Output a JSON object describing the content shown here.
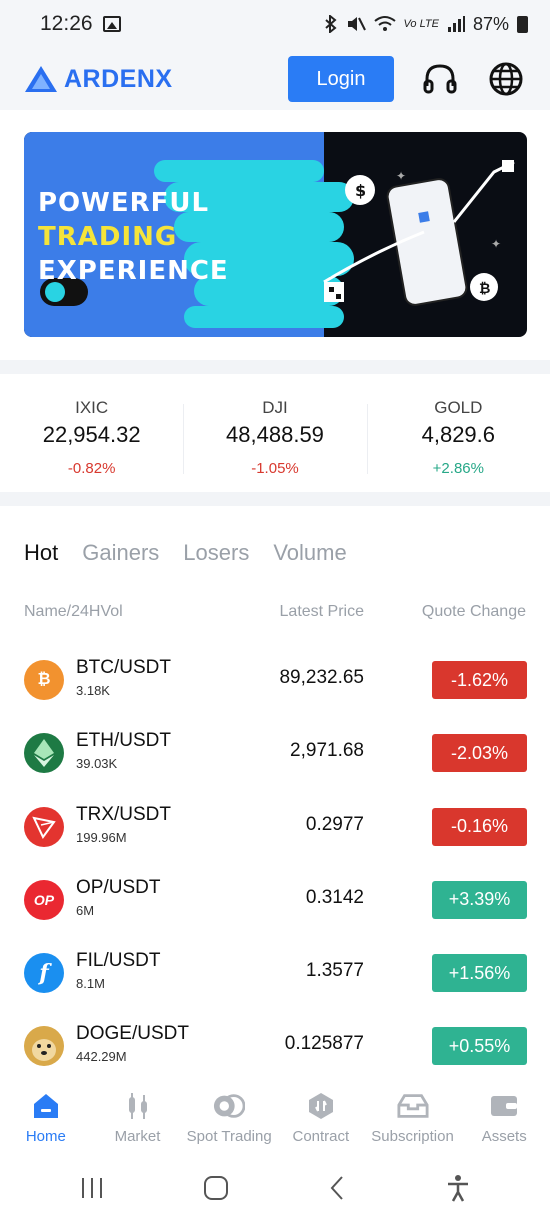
{
  "status_bar": {
    "time": "12:26",
    "battery": "87%",
    "network": "Vo LTE"
  },
  "header": {
    "logo_text": "ARDENX",
    "login_label": "Login",
    "support_icon": "headset-icon",
    "language_icon": "globe-icon"
  },
  "banner": {
    "line1": "POWERFUL",
    "line2": "TRADING",
    "line3": "EXPERIENCE"
  },
  "indices": [
    {
      "name": "IXIC",
      "value": "22,954.32",
      "change": "-0.82%",
      "trend": "down"
    },
    {
      "name": "DJI",
      "value": "48,488.59",
      "change": "-1.05%",
      "trend": "down"
    },
    {
      "name": "GOLD",
      "value": "4,829.6",
      "change": "+2.86%",
      "trend": "up"
    }
  ],
  "tabs": [
    "Hot",
    "Gainers",
    "Losers",
    "Volume"
  ],
  "active_tab": "Hot",
  "columns": {
    "name": "Name/24HVol",
    "price": "Latest Price",
    "change": "Quote Change"
  },
  "markets": [
    {
      "pair": "BTC/USDT",
      "volume": "3.18K",
      "price": "89,232.65",
      "change": "-1.62%",
      "trend": "down",
      "icon": "bitcoin-icon",
      "color": "#f2922f"
    },
    {
      "pair": "ETH/USDT",
      "volume": "39.03K",
      "price": "2,971.68",
      "change": "-2.03%",
      "trend": "down",
      "icon": "ethereum-icon",
      "color": "#1e7a44"
    },
    {
      "pair": "TRX/USDT",
      "volume": "199.96M",
      "price": "0.2977",
      "change": "-0.16%",
      "trend": "down",
      "icon": "tron-icon",
      "color": "#e3342f"
    },
    {
      "pair": "OP/USDT",
      "volume": "6M",
      "price": "0.3142",
      "change": "+3.39%",
      "trend": "up",
      "icon": "optimism-icon",
      "color": "#ea2831",
      "glyph": "OP"
    },
    {
      "pair": "FIL/USDT",
      "volume": "8.1M",
      "price": "1.3577",
      "change": "+1.56%",
      "trend": "up",
      "icon": "filecoin-icon",
      "color": "#1a8ff0",
      "glyph": "f"
    },
    {
      "pair": "DOGE/USDT",
      "volume": "442.29M",
      "price": "0.125877",
      "change": "+0.55%",
      "trend": "up",
      "icon": "dogecoin-icon",
      "color": "#d9a94a"
    }
  ],
  "bottom_nav": [
    {
      "label": "Home",
      "icon": "home-icon",
      "active": true
    },
    {
      "label": "Market",
      "icon": "market-icon",
      "active": false
    },
    {
      "label": "Spot Trading",
      "icon": "spot-trading-icon",
      "active": false
    },
    {
      "label": "Contract",
      "icon": "contract-icon",
      "active": false
    },
    {
      "label": "Subscription",
      "icon": "subscription-icon",
      "active": false
    },
    {
      "label": "Assets",
      "icon": "wallet-icon",
      "active": false
    }
  ],
  "colors": {
    "brand": "#2a7cf5",
    "down": "#d9372d",
    "up": "#2fb392"
  }
}
